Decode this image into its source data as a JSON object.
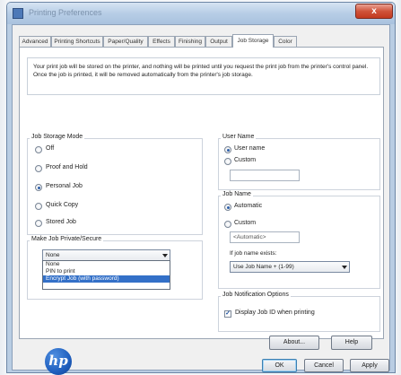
{
  "window": {
    "title": "Printing Preferences",
    "close_label": "x"
  },
  "tabs": [
    {
      "label": "Advanced"
    },
    {
      "label": "Printing Shortcuts"
    },
    {
      "label": "Paper/Quality"
    },
    {
      "label": "Effects"
    },
    {
      "label": "Finishing"
    },
    {
      "label": "Output"
    },
    {
      "label": "Job Storage"
    },
    {
      "label": "Color"
    }
  ],
  "active_tab": "Job Storage",
  "info_text": "Your print job will be stored on the printer, and nothing will be printed until you request the print job from the printer's control panel. Once the job is printed, it will be removed automatically from the printer's job storage.",
  "job_storage_mode": {
    "title": "Job Storage Mode",
    "options": [
      {
        "label": "Off",
        "selected": false
      },
      {
        "label": "Proof and Hold",
        "selected": false
      },
      {
        "label": "Personal Job",
        "selected": true
      },
      {
        "label": "Quick Copy",
        "selected": false
      },
      {
        "label": "Stored Job",
        "selected": false
      }
    ]
  },
  "private": {
    "title": "Make Job Private/Secure",
    "value": "None",
    "options": [
      "None",
      "PIN to print",
      "Encrypt Job (with password)"
    ],
    "highlighted": "Encrypt Job (with password)"
  },
  "user_name": {
    "title": "User Name",
    "options": [
      {
        "label": "User name",
        "selected": true
      },
      {
        "label": "Custom",
        "selected": false
      }
    ],
    "custom_value": ""
  },
  "job_name": {
    "title": "Job Name",
    "options": [
      {
        "label": "Automatic",
        "selected": true
      },
      {
        "label": "Custom",
        "selected": false
      }
    ],
    "custom_value": "<Automatic>",
    "exists_label": "If job name exists:",
    "exists_value": "Use Job Name + (1-99)"
  },
  "notification": {
    "title": "Job Notification Options",
    "display_label": "Display Job ID when printing",
    "display_checked": true
  },
  "buttons": {
    "about": "About...",
    "help": "Help",
    "ok": "OK",
    "cancel": "Cancel",
    "apply": "Apply"
  },
  "logo": "hp",
  "colors": {
    "selection": "#3370c8",
    "title_bar": "#b7cde6",
    "close": "#d0533a"
  }
}
